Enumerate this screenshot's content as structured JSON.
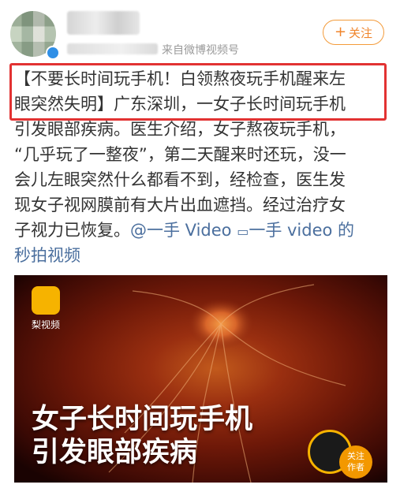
{
  "header": {
    "source": "来自微博视频号",
    "follow_label": "关注"
  },
  "post": {
    "lines": [
      "【不要长时间玩手机！白领熬夜玩手机醒来左",
      "眼突然失明】广东深圳，一女子长时间玩手机",
      "引发眼部疾病。医生介绍，女子熬夜玩手机，",
      "“几乎玩了一整夜”，第二天醒来时还玩，没一",
      "会儿左眼突然什么都看不到，经检查，医生发",
      "现女子视网膜前有大片出血遮挡。经过治疗女"
    ],
    "line7_text": "子视力已恢复。",
    "mention": "@一手 Video",
    "video_link": "一手 video 的",
    "line8": "秒拍视频"
  },
  "video": {
    "brand": "梨视频",
    "caption_line1": "女子长时间玩手机",
    "caption_line2": "引发眼部疾病",
    "follow_line1": "关注",
    "follow_line2": "作者"
  },
  "colors": {
    "follow": "#f0852b",
    "highlight": "#e23232",
    "link": "#4b6f9e",
    "brand": "#f6b300"
  }
}
